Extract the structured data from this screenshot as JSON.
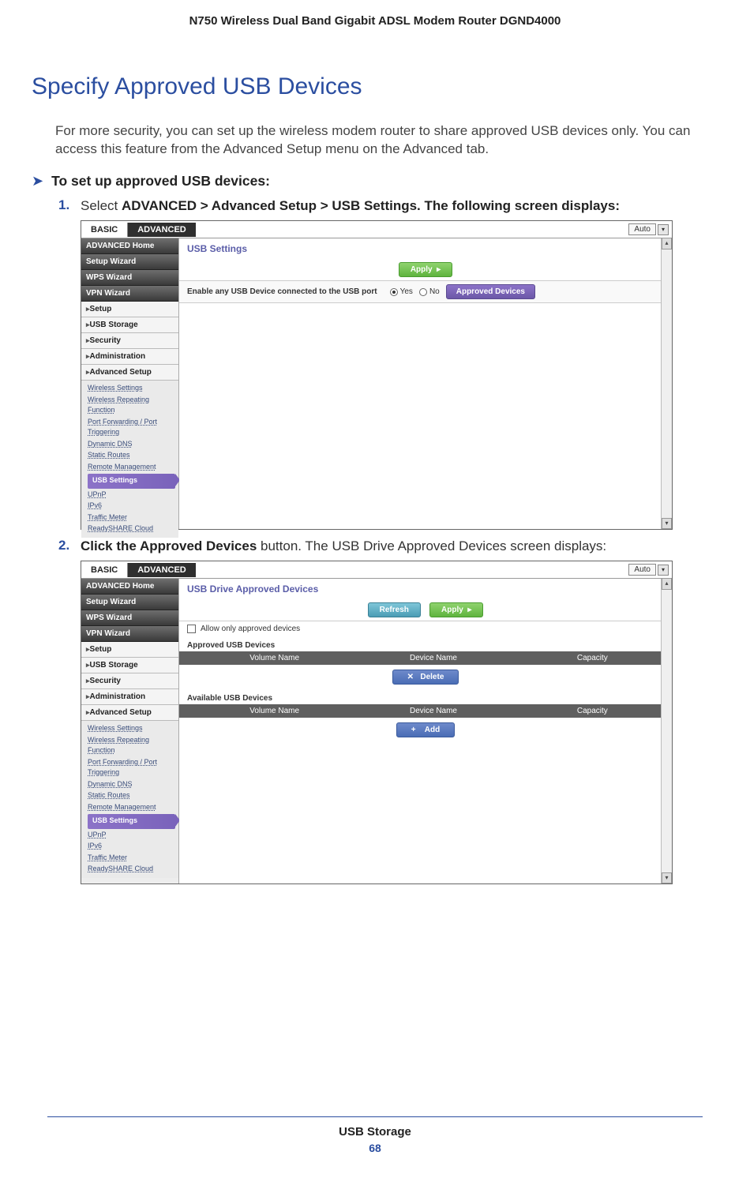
{
  "header": "N750 Wireless Dual Band Gigabit ADSL Modem Router DGND4000",
  "section_title": "Specify Approved USB Devices",
  "intro": "For more security, you can set up the wireless modem router to share approved USB devices only. You can access this feature from the Advanced Setup menu on the Advanced tab.",
  "proc_title": "To set up approved USB devices:",
  "step1_num": "1.",
  "step1_pre": "Select ",
  "step1_bold": "ADVANCED > Advanced Setup > USB Settings. The following screen displays:",
  "step2_num": "2.",
  "step2_bold": "Click the Approved Devices",
  "step2_rest": " button. The USB Drive Approved Devices screen displays:",
  "tabs": {
    "basic": "BASIC",
    "advanced": "ADVANCED",
    "auto": "Auto"
  },
  "nav": {
    "home": "ADVANCED Home",
    "setup_wiz": "Setup Wizard",
    "wps_wiz": "WPS Wizard",
    "vpn_wiz": "VPN Wizard",
    "setup": "Setup",
    "usb_storage": "USB Storage",
    "security": "Security",
    "admin": "Administration",
    "adv_setup": "Advanced Setup"
  },
  "sub": {
    "wireless_settings": "Wireless Settings",
    "wireless_repeat": "Wireless Repeating Function",
    "port_fwd": "Port Forwarding / Port Triggering",
    "dyn_dns": "Dynamic DNS",
    "static_routes": "Static Routes",
    "remote_mgmt": "Remote Management",
    "usb_settings": "USB Settings",
    "upnp": "UPnP",
    "ipv6": "IPv6",
    "traffic": "Traffic Meter",
    "readyshare": "ReadySHARE Cloud"
  },
  "panel1": {
    "title": "USB Settings",
    "apply": "Apply",
    "enable_label": "Enable any USB Device connected to the USB port",
    "yes": "Yes",
    "no": "No",
    "approved_btn": "Approved Devices"
  },
  "panel2": {
    "title": "USB Drive Approved Devices",
    "refresh": "Refresh",
    "apply": "Apply",
    "allow_only": "Allow only approved devices",
    "approved_label": "Approved USB Devices",
    "available_label": "Available USB Devices",
    "col_vol": "Volume Name",
    "col_dev": "Device Name",
    "col_cap": "Capacity",
    "delete": "Delete",
    "add": "Add"
  },
  "footer": {
    "section": "USB Storage",
    "page": "68"
  }
}
